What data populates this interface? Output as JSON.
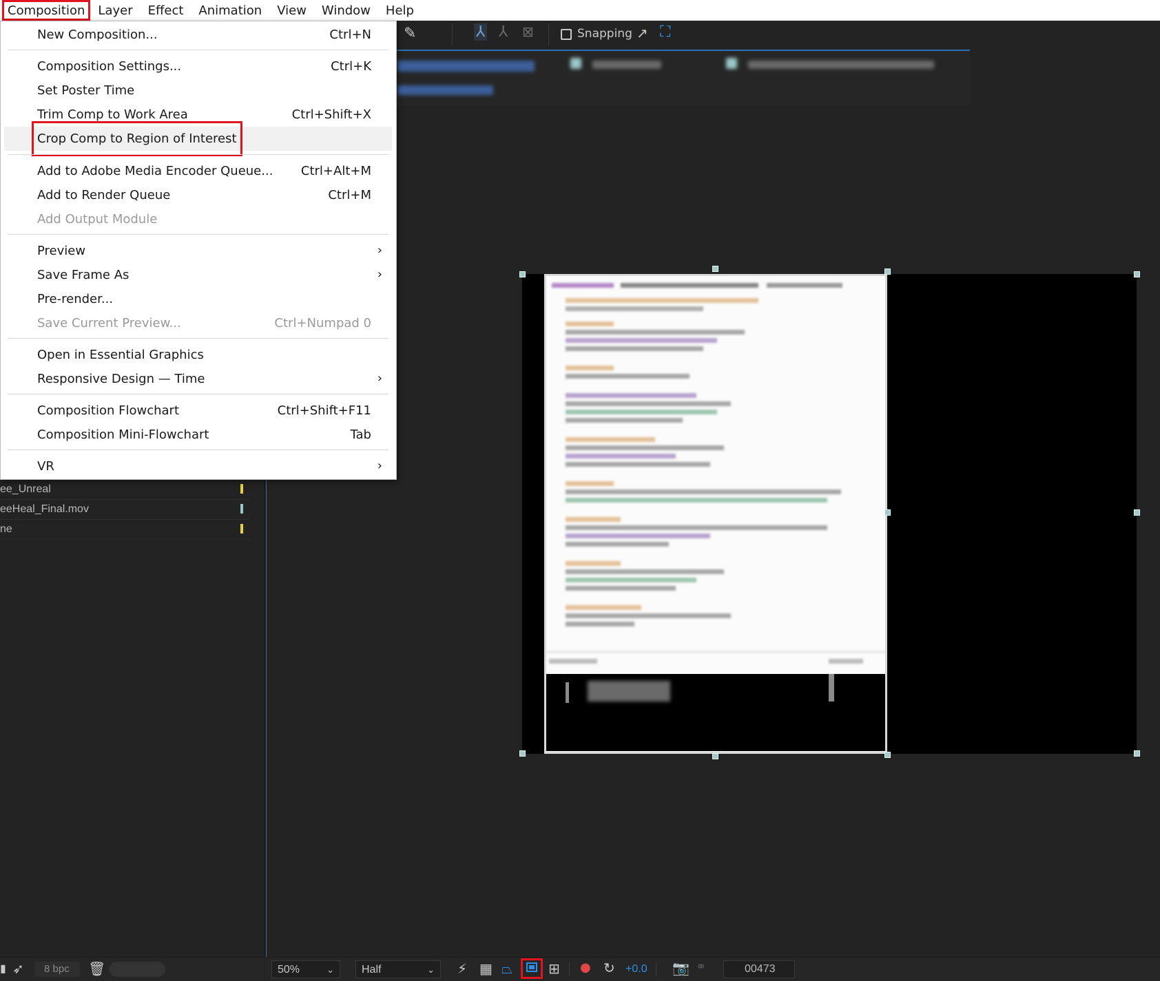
{
  "menubar": {
    "items": [
      "Composition",
      "Layer",
      "Effect",
      "Animation",
      "View",
      "Window",
      "Help"
    ],
    "active": "Composition"
  },
  "menu": {
    "items": [
      {
        "label": "New Composition...",
        "shortcut": "Ctrl+N"
      },
      {
        "label": "Composition Settings...",
        "shortcut": "Ctrl+K"
      },
      {
        "label": "Set Poster Time",
        "shortcut": ""
      },
      {
        "label": "Trim Comp to Work Area",
        "shortcut": "Ctrl+Shift+X"
      },
      {
        "label": "Crop Comp to Region of Interest",
        "shortcut": "",
        "highlighted": true
      },
      {
        "label": "Add to Adobe Media Encoder Queue...",
        "shortcut": "Ctrl+Alt+M"
      },
      {
        "label": "Add to Render Queue",
        "shortcut": "Ctrl+M"
      },
      {
        "label": "Add Output Module",
        "shortcut": "",
        "disabled": true
      },
      {
        "label": "Preview",
        "submenu": true
      },
      {
        "label": "Save Frame As",
        "submenu": true
      },
      {
        "label": "Pre-render...",
        "shortcut": ""
      },
      {
        "label": "Save Current Preview...",
        "shortcut": "Ctrl+Numpad 0",
        "disabled": true
      },
      {
        "label": "Open in Essential Graphics",
        "shortcut": ""
      },
      {
        "label": "Responsive Design — Time",
        "submenu": true
      },
      {
        "label": "Composition Flowchart",
        "shortcut": "Ctrl+Shift+F11"
      },
      {
        "label": "Composition Mini-Flowchart",
        "shortcut": "Tab"
      },
      {
        "label": "VR",
        "submenu": true
      }
    ],
    "submenu_arrow": "›"
  },
  "toolbar": {
    "snapping_label": "Snapping"
  },
  "project_list": [
    {
      "name": "ee_Unreal",
      "color": "#e6d23a"
    },
    {
      "name": "eeHeal_Final.mov",
      "color": "#9cc7c8"
    },
    {
      "name": "ne",
      "color": "#e6d23a"
    }
  ],
  "left_footer": {
    "bit_depth": "8 bpc"
  },
  "viewer_footer": {
    "zoom": "50%",
    "resolution": "Half",
    "exposure": "+0.0",
    "timecode": "00473",
    "region_of_interest_active": true
  },
  "colors": {
    "highlight_box": "#e0141e",
    "accent_blue": "#2f8fe8",
    "panel_bg": "#232323"
  }
}
